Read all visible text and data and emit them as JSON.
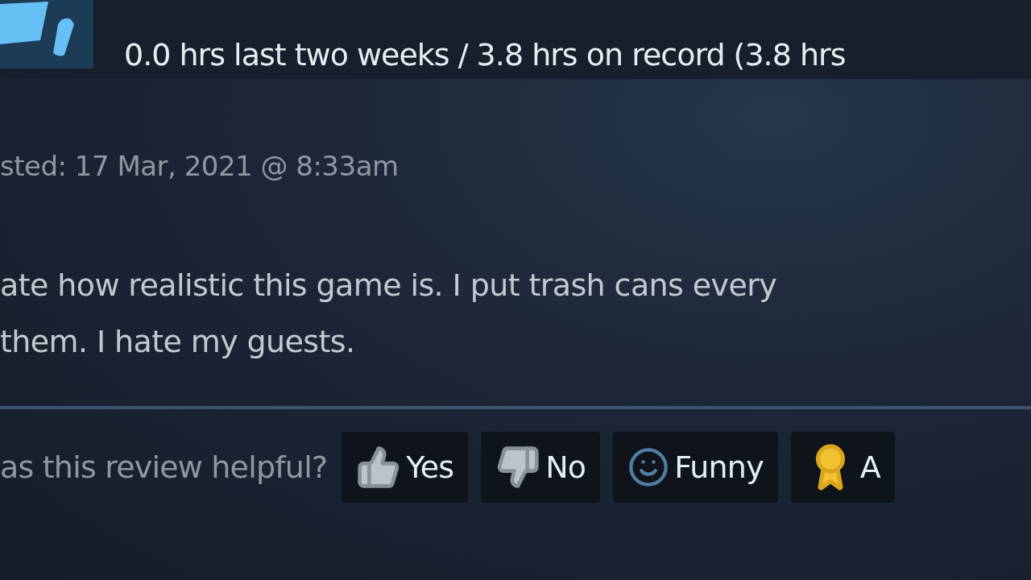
{
  "playtime": "0.0 hrs last two weeks / 3.8 hrs on record (3.8 hrs",
  "posted": "sted: 17 Mar, 2021 @ 8:33am",
  "review_lines": [
    "ate how realistic this game is. I put trash cans every",
    "them. I hate my guests."
  ],
  "helpful_prompt": "as this review helpful?",
  "buttons": [
    {
      "kind": "yes",
      "label": "Yes"
    },
    {
      "kind": "no",
      "label": "No"
    },
    {
      "kind": "funny",
      "label": "Funny"
    },
    {
      "kind": "award",
      "label": "A"
    }
  ]
}
